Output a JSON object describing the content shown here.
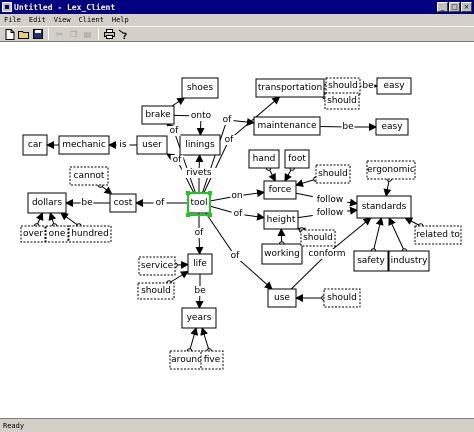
{
  "window": {
    "title": "Untitled - Lex_Client"
  },
  "window_buttons": {
    "minimize": "_",
    "maximize": "□",
    "close": "×"
  },
  "menu": [
    "File",
    "Edit",
    "View",
    "Client",
    "Help"
  ],
  "toolbar": {
    "new": "new-file-icon",
    "open": "open-folder-icon",
    "save": "save-icon",
    "cut": "cut-icon",
    "copy": "copy-icon",
    "paste": "paste-icon",
    "print": "print-icon",
    "help": "help-icon"
  },
  "graph": {
    "concepts": {
      "shoes": "shoes",
      "brake": "brake",
      "linings": "linings",
      "transportation": "transportation",
      "easy1": "easy",
      "maintenance": "maintenance",
      "easy2": "easy",
      "car": "car",
      "mechanic": "mechanic",
      "user": "user",
      "hand": "hand",
      "foot": "foot",
      "force": "force",
      "height": "height",
      "working": "working",
      "standards": "standards",
      "safety": "safety",
      "industry": "industry",
      "dollars": "dollars",
      "cost": "cost",
      "tool": "tool",
      "life": "life",
      "years": "years",
      "use": "use"
    },
    "modifiers": {
      "should1": "should",
      "should2": "should",
      "cannot": "cannot",
      "should3": "should",
      "should4": "should",
      "ergonomic": "ergonomic",
      "related_to": "related to",
      "over": "over",
      "one": "one",
      "hundred": "hundred",
      "service": "service",
      "should5": "should",
      "should6": "should",
      "around": "around",
      "five": "five"
    },
    "relations": {
      "onto": "onto",
      "of1": "of",
      "rivets": "rivets",
      "of2": "of",
      "of3": "of",
      "be1": "be",
      "be2": "be",
      "is": "is",
      "of4": "of",
      "of5": "of",
      "be3": "be",
      "of6": "of",
      "on": "on",
      "of7": "of",
      "follow1": "follow",
      "follow2": "follow",
      "conform": "conform",
      "of8": "of",
      "of9": "of",
      "be4": "be"
    }
  },
  "status": "Ready"
}
